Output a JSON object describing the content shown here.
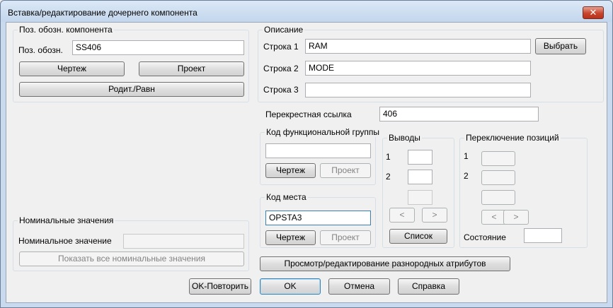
{
  "window": {
    "title": "Вставка/редактирование дочернего компонента",
    "close_label": "✕"
  },
  "tag_group": {
    "title": "Поз. обозн. компонента",
    "tag_label": "Поз. обозн.",
    "tag_value": "SS406",
    "drawing_button": "Чертеж",
    "project_button": "Проект",
    "parent_button": "Родит./Равн"
  },
  "description": {
    "title": "Описание",
    "line1_label": "Строка 1",
    "line1_value": "RAM",
    "line2_label": "Строка 2",
    "line2_value": "MODE",
    "line3_label": "Строка 3",
    "line3_value": "",
    "select_button": "Выбрать"
  },
  "crossref": {
    "label": "Перекрестная ссылка",
    "value": "406"
  },
  "function_group": {
    "title": "Код функциональной группы",
    "value": "",
    "drawing_button": "Чертеж",
    "project_button": "Проект"
  },
  "location": {
    "title": "Код места",
    "value": "OPSTA3",
    "drawing_button": "Чертеж",
    "project_button": "Проект"
  },
  "pins": {
    "title": "Выводы",
    "pin1_label": "1",
    "pin1_value": "",
    "pin2_label": "2",
    "pin2_value": "",
    "pin3_value": "",
    "prev_label": "<",
    "next_label": ">",
    "list_button": "Список"
  },
  "position_switch": {
    "title": "Переключение позиций",
    "pos1_label": "1",
    "pos2_label": "2",
    "prev_label": "<",
    "next_label": ">",
    "state_label": "Состояние",
    "state_value": ""
  },
  "ratings": {
    "title": "Номинальные значения",
    "rating_label": "Номинальное значение",
    "rating_value": "",
    "show_all_button": "Показать все номинальные значения"
  },
  "attrs_button": "Просмотр/редактирование разнородных атрибутов",
  "footer": {
    "ok_repeat": "OK-Повторить",
    "ok": "OK",
    "cancel": "Отмена",
    "help": "Справка"
  }
}
